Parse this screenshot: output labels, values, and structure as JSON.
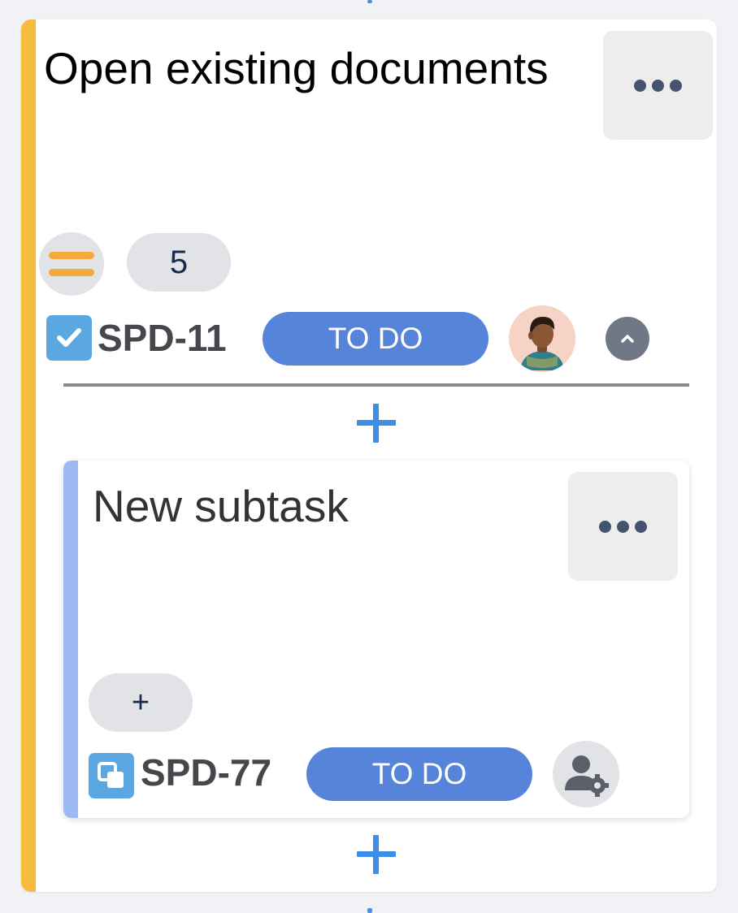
{
  "parent_task": {
    "title": "Open existing documents",
    "accent_color": "#f6bb3f",
    "priority_icon": "priority-medium-icon",
    "count": "5",
    "type_icon": "checkbox-icon",
    "key": "SPD-11",
    "status": "TO DO",
    "status_color": "#5684db",
    "avatar": "user-avatar",
    "collapse_icon": "chevron-up-icon"
  },
  "subtask": {
    "title": "New subtask",
    "accent_color": "#9ebaf4",
    "add_label": "+",
    "type_icon": "subtask-icon",
    "key": "SPD-77",
    "status": "TO DO",
    "status_color": "#5684db",
    "assign_icon": "user-settings-icon"
  },
  "icons": {
    "more": "more-options-icon",
    "add": "plus-icon"
  }
}
